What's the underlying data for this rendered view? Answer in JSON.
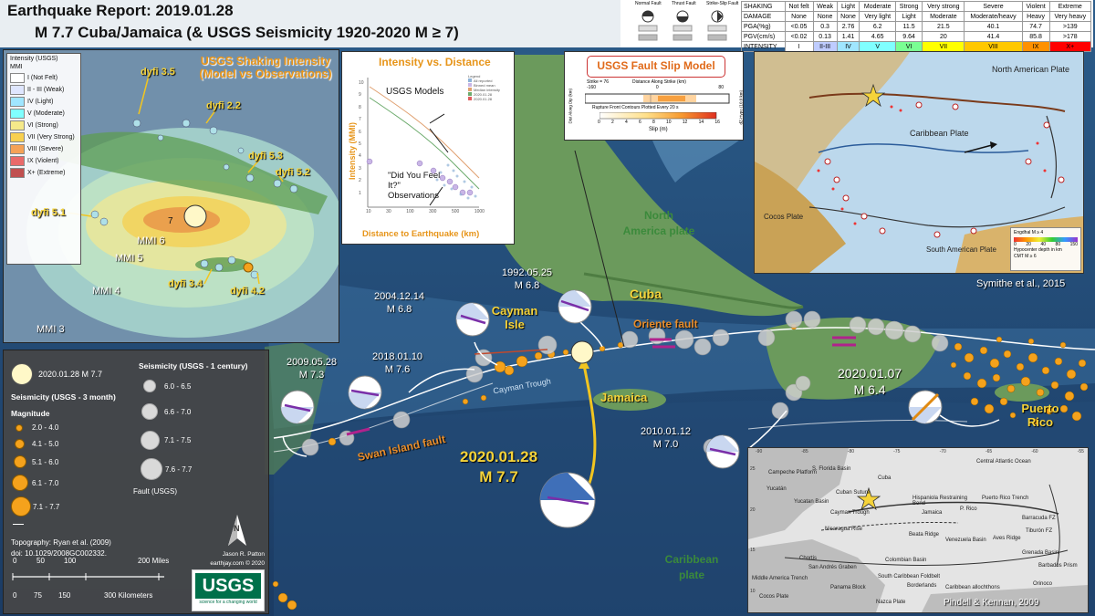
{
  "header": {
    "title_line1": "Earthquake Report: 2019.01.28",
    "title_line2": "M 7.7 Cuba/Jamaica (& USGS Seismicity 1920-2020 M ≥ 7)"
  },
  "fault_types": {
    "normal": "Normal Fault",
    "thrust": "Thrust Fault",
    "strike_slip": "Strike-Slip Fault"
  },
  "shaking_table": {
    "rows": [
      {
        "label": "SHAKING",
        "cells": [
          "Not felt",
          "Weak",
          "Light",
          "Moderate",
          "Strong",
          "Very strong",
          "Severe",
          "Violent",
          "Extreme"
        ]
      },
      {
        "label": "DAMAGE",
        "cells": [
          "None",
          "None",
          "None",
          "Very light",
          "Light",
          "Moderate",
          "Moderate/heavy",
          "Heavy",
          "Very heavy"
        ]
      },
      {
        "label": "PGA(%g)",
        "cells": [
          "<0.05",
          "0.3",
          "2.76",
          "6.2",
          "11.5",
          "21.5",
          "40.1",
          "74.7",
          ">139"
        ]
      },
      {
        "label": "PGV(cm/s)",
        "cells": [
          "<0.02",
          "0.13",
          "1.41",
          "4.65",
          "9.64",
          "20",
          "41.4",
          "85.8",
          ">178"
        ]
      },
      {
        "label": "INTENSITY",
        "cells": [
          "I",
          "II-III",
          "IV",
          "V",
          "VI",
          "VII",
          "VIII",
          "IX",
          "X+"
        ]
      }
    ],
    "intensity_colors": [
      "#ffffff",
      "#bfccff",
      "#a0e6ff",
      "#80ffff",
      "#7aff93",
      "#ffff00",
      "#ffc800",
      "#ff9100",
      "#ff0000"
    ]
  },
  "shaking_inset": {
    "title": "USGS Shaking Intensity",
    "subtitle": "(Model vs Observations)",
    "legend_title": "Intensity (USGS)",
    "legend_sub": "MMI",
    "legend_items": [
      {
        "label": "I (Not Felt)",
        "color": "#ffffff"
      },
      {
        "label": "II - III (Weak)",
        "color": "#dfe6fe"
      },
      {
        "label": "IV (Light)",
        "color": "#a0e6ff"
      },
      {
        "label": "V (Moderate)",
        "color": "#80ffff"
      },
      {
        "label": "VI (Strong)",
        "color": "#f5e98a"
      },
      {
        "label": "VII (Very Strong)",
        "color": "#f8d050"
      },
      {
        "label": "VIII (Severe)",
        "color": "#f5a257"
      },
      {
        "label": "IX (Violent)",
        "color": "#e96a6a"
      },
      {
        "label": "X+ (Extreme)",
        "color": "#c05050"
      }
    ],
    "dyfi_labels": [
      "dyfi 3.5",
      "dyfi 2.2",
      "dyfi 5.3",
      "dyfi 5.2",
      "dyfi 5.1",
      "dyfi 3.4",
      "dyfi 4.2"
    ],
    "mmi_labels": [
      "MMI 6",
      "MMI 5",
      "MMI 4",
      "MMI 3"
    ],
    "epicenter_label": "7"
  },
  "intensity_distance": {
    "title": "Intensity vs. Distance",
    "ylabel": "Intensity (MMI)",
    "xlabel": "Distance to Earthquake (km)",
    "models_label": "USGS Models",
    "dyfi_label": "\"Did You Feel It?\" Observations",
    "legend_title": "Legend",
    "legend_items": [
      "All reported",
      "Binned mean",
      "Median intensity",
      "2020.01.28",
      "2020.01.28"
    ],
    "y_ticks": [
      "10",
      "9",
      "8",
      "7",
      "6",
      "5",
      "4",
      "3",
      "2",
      "1"
    ],
    "x_ticks": [
      "10",
      "30",
      "100",
      "300",
      "500",
      "1000"
    ]
  },
  "fault_slip": {
    "title": "USGS Fault Slip Model",
    "strike": "Strike = 76",
    "x_label": "Distance Along Strike (km)",
    "x_ticks": [
      "-160",
      "0",
      "80"
    ],
    "y_label": "Dist Along Dip (km)",
    "y_right": "dZ-Hypo (10.0 km)",
    "rupture_note": "Rupture Front Contours Plotted Every 20 s",
    "slip_label": "Slip (m)",
    "slip_ticks": [
      "0",
      "2",
      "4",
      "6",
      "8",
      "10",
      "12",
      "14",
      "16"
    ]
  },
  "tectonic_inset": {
    "labels": [
      "North American Plate",
      "Caribbean Plate",
      "Cocos Plate",
      "South American Plate"
    ],
    "legend_engdahl": "Engdhal  M ≥ 4",
    "legend_depth": "Hypocenter depth in km",
    "legend_cmt": "CMT M ≥ 6",
    "depth_ticks": [
      "0",
      "20",
      "40",
      "80",
      "150"
    ],
    "credit": "Symithe et al., 2015"
  },
  "main_map": {
    "labels": {
      "north_america": "North America plate",
      "caribbean": "Caribbean plate",
      "cuba": "Cuba",
      "cayman": "Cayman Isle",
      "jamaica": "Jamaica",
      "puerto_rico": "Puerto Rico",
      "oriente_fault": "Oriente fault",
      "swan_island": "Swan Island fault",
      "cayman_trough": "Cayman Trough"
    },
    "events": [
      {
        "date": "2004.12.14",
        "mag": "M 6.8"
      },
      {
        "date": "1992.05.25",
        "mag": "M 6.8"
      },
      {
        "date": "2018.01.10",
        "mag": "M 7.6"
      },
      {
        "date": "2009.05.28",
        "mag": "M 7.3"
      },
      {
        "date": "2010.01.12",
        "mag": "M 7.0"
      },
      {
        "date": "2020.01.07",
        "mag": "M 6.4"
      },
      {
        "date": "2020.01.28",
        "mag": "M 7.7"
      }
    ]
  },
  "legend": {
    "mainshock": "2020.01.28 M 7.7",
    "seis_3mo": "Seismicity (USGS  - 3 month)",
    "magnitude": "Magnitude",
    "mag_bins": [
      "2.0 - 4.0",
      "4.1 - 5.0",
      "5.1 - 6.0",
      "6.1 - 7.0",
      "7.1 - 7.7"
    ],
    "seis_century": "Seismicity (USGS - 1 century)",
    "century_bins": [
      "6.0 - 6.5",
      "6.6 - 7.0",
      "7.1 - 7.5",
      "7.6 - 7.7"
    ],
    "fault": "Fault  (USGS)",
    "topo": "Topography: Ryan et al. (2009)",
    "doi": "doi: 10.1029/2008GC002332.",
    "miles_ticks": [
      "0",
      "50",
      "100",
      "200 Miles"
    ],
    "km_ticks": [
      "0",
      "75",
      "150",
      "300 Kilometers"
    ],
    "north": "N",
    "author": "Jason R. Patton",
    "site": "earthjay.com © 2020",
    "usgs": "USGS",
    "usgs_tag": "science for a changing world"
  },
  "geology_inset": {
    "labels": [
      "Central Atlantic Ocean",
      "S. Florida Basin",
      "Campeche Platform",
      "Yucatán",
      "Yucatan Basin",
      "Cuban Suture",
      "Cayman Trough",
      "Hispaniola Restraining Bend",
      "Puerto Rico Trench",
      "P. Rico",
      "Barracuda FZ",
      "Tiburón FZ",
      "Nicaragua Rise",
      "Beata Ridge",
      "Venezuela Basin",
      "Aves Ridge",
      "Grenada Basin",
      "Barbados Prism",
      "Chortis",
      "San Andrés Graben",
      "Colombian Basin",
      "South Caribbean Foldbelt",
      "Borderlands",
      "Middle America Trench",
      "Cocos Plate",
      "Panama Block",
      "Nazca Plate",
      "Orinoco",
      "Caribbean allochthons",
      "Jamaica",
      "Cuba"
    ],
    "credit": "Pindell & Kennan, 2009",
    "lon_ticks": [
      "-90",
      "-85",
      "-80",
      "-75",
      "-70",
      "-65",
      "-60",
      "-55"
    ],
    "lat_ticks": [
      "25",
      "20",
      "15",
      "10"
    ]
  }
}
